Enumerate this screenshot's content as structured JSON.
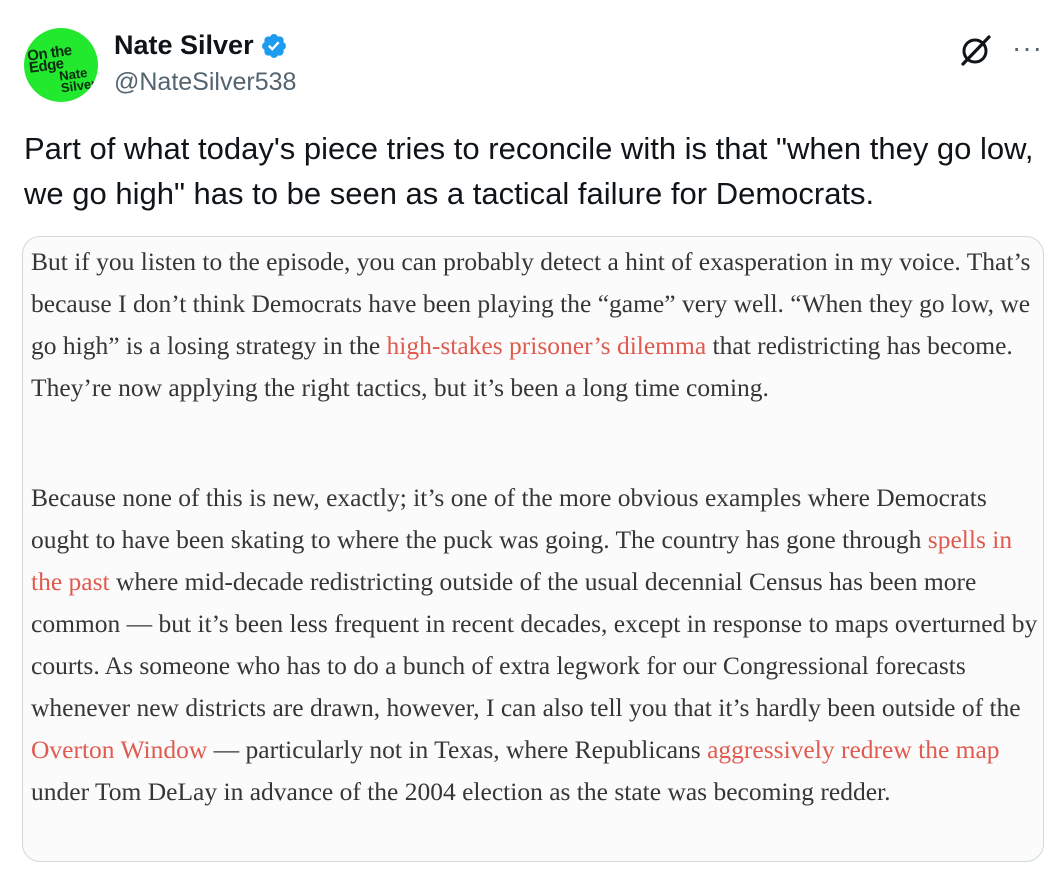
{
  "author": {
    "name": "Nate Silver",
    "handle": "@NateSilver538",
    "avatar_text_top": "On the Edge",
    "avatar_text_bottom": "Nate Silver",
    "avatar_color": "#22e82e",
    "verified_color": "#1d9bf0"
  },
  "actions": {
    "grok_icon": "grok-icon",
    "more_label": "···"
  },
  "tweet": {
    "text": "Part of what today's piece tries to reconcile with is that \"when they go low, we go high\" has to be seen as a tactical failure for Democrats."
  },
  "quote": {
    "p1": {
      "t1": "But if you listen to the episode, you can probably detect a hint of exasperation in my voice. That’s because I don’t think Democrats have been playing the “game” very well. “When they go low, we go high” is a losing strategy in the ",
      "link1": "high-stakes prisoner’s dilemma",
      "t2": " that redistricting has become. They’re now applying the right tactics, but it’s been a long time coming."
    },
    "p2": {
      "t1": "Because none of this is new, exactly; it’s one of the more obvious examples where Democrats ought to have been skating to where the puck was going. The country has gone through ",
      "link1": "spells in the past",
      "t2": " where mid-decade redistricting outside of the usual decennial Census has been more common — but it’s been less frequent in recent decades, except in response to maps overturned by courts. As someone who has to do a bunch of extra legwork for our Congressional forecasts whenever new districts are drawn, however, I can also tell you that it’s hardly been outside of the ",
      "link2": "Overton Window",
      "t3": " — particularly not in Texas, where Republicans ",
      "link3": "aggressively redrew the map",
      "t4": " under Tom DeLay in advance of the 2004 election as the state was becoming redder."
    },
    "link_color": "#e05a4f"
  }
}
